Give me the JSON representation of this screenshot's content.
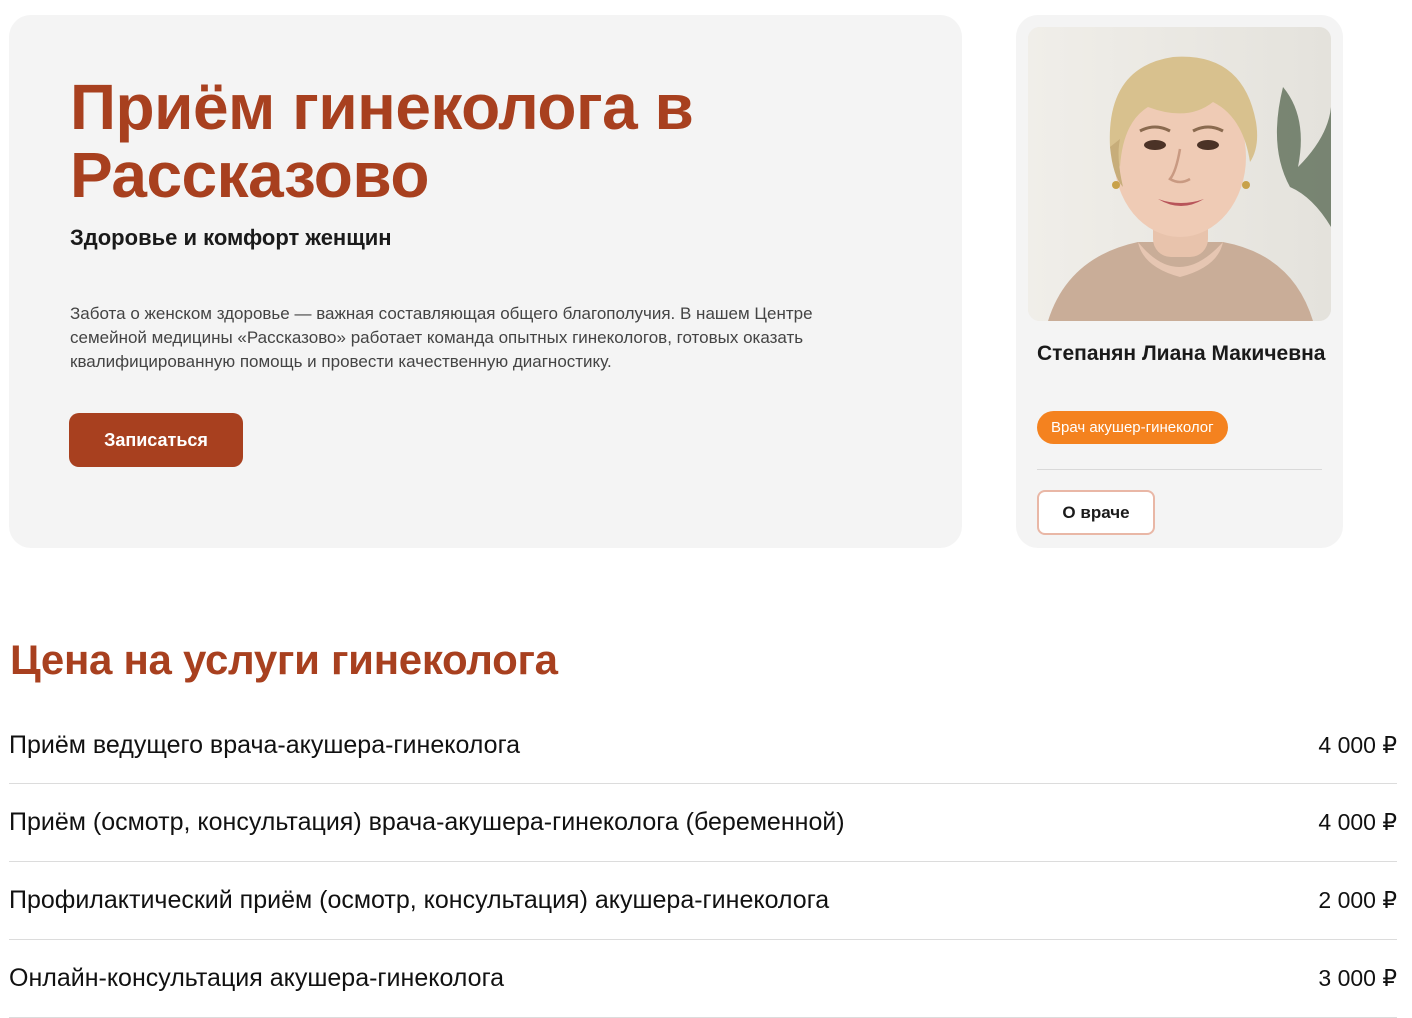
{
  "hero": {
    "title": "Приём гинеколога в Рассказово",
    "subtitle": "Здоровье и комфорт женщин",
    "text": "Забота о женском здоровье — важная составляющая общего благополучия. В нашем Центре семейной медицины «Рассказово» работает команда опытных гинекологов, готовых оказать квалифицированную помощь и провести качественную диагностику.",
    "button_label": "Записаться"
  },
  "doctor": {
    "name": "Степанян Лиана Макичевна",
    "role": "Врач акушер-гинеколог",
    "button_label": "О враче"
  },
  "prices": {
    "title": "Цена на услуги гинеколога",
    "items": [
      {
        "name": "Приём ведущего врача-акушера-гинеколога",
        "price": "4 000 ₽"
      },
      {
        "name": "Приём (осмотр, консультация) врача-акушера-гинеколога (беременной)",
        "price": "4 000 ₽"
      },
      {
        "name": "Профилактический приём (осмотр, консультация) акушера-гинеколога",
        "price": "2 000 ₽"
      },
      {
        "name": "Онлайн-консультация акушера-гинеколога",
        "price": "3 000 ₽"
      }
    ]
  },
  "colors": {
    "accent": "#a8401f",
    "badge": "#f4821f",
    "card_bg": "#f4f4f4"
  }
}
